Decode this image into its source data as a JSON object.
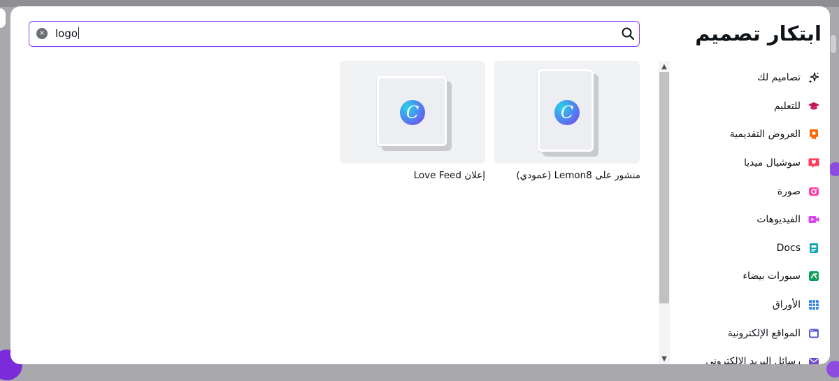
{
  "sidebar": {
    "title": "ابتكار تصميم",
    "items": [
      {
        "label": "تصاميم لك",
        "icon": "sparkles-icon",
        "color": "#0e1318"
      },
      {
        "label": "للتعليم",
        "icon": "graduation-cap-icon",
        "color": "#c2185b"
      },
      {
        "label": "العروض التقديمية",
        "icon": "award-icon",
        "color": "#ff6a00"
      },
      {
        "label": "سوشيال ميديا",
        "icon": "heart-chat-icon",
        "color": "#ff3b5c"
      },
      {
        "label": "صورة",
        "icon": "camera-icon",
        "color": "#ff3fa4"
      },
      {
        "label": "الفيديوهات",
        "icon": "video-icon",
        "color": "#d946ef"
      },
      {
        "label": "Docs",
        "icon": "doc-icon",
        "color": "#13a3b5"
      },
      {
        "label": "سبورات بيضاء",
        "icon": "whiteboard-icon",
        "color": "#0ea05a"
      },
      {
        "label": "الأوراق",
        "icon": "sheet-icon",
        "color": "#2f80ed"
      },
      {
        "label": "المواقع الإلكترونية",
        "icon": "website-icon",
        "color": "#5b5bd6"
      },
      {
        "label": "رسائل البريد الإلكتروني",
        "icon": "mail-icon",
        "color": "#6d4bd8"
      }
    ]
  },
  "search": {
    "value": "logo",
    "placeholder": "",
    "clear_icon": "×"
  },
  "results": [
    {
      "label": "منشور على Lemon8 (عمودي)",
      "logo_letter": "C"
    },
    {
      "label": "إعلان Love Feed",
      "logo_letter": "C"
    }
  ],
  "colors": {
    "accent": "#8b3dff",
    "card_bg": "#f1f2f4"
  }
}
